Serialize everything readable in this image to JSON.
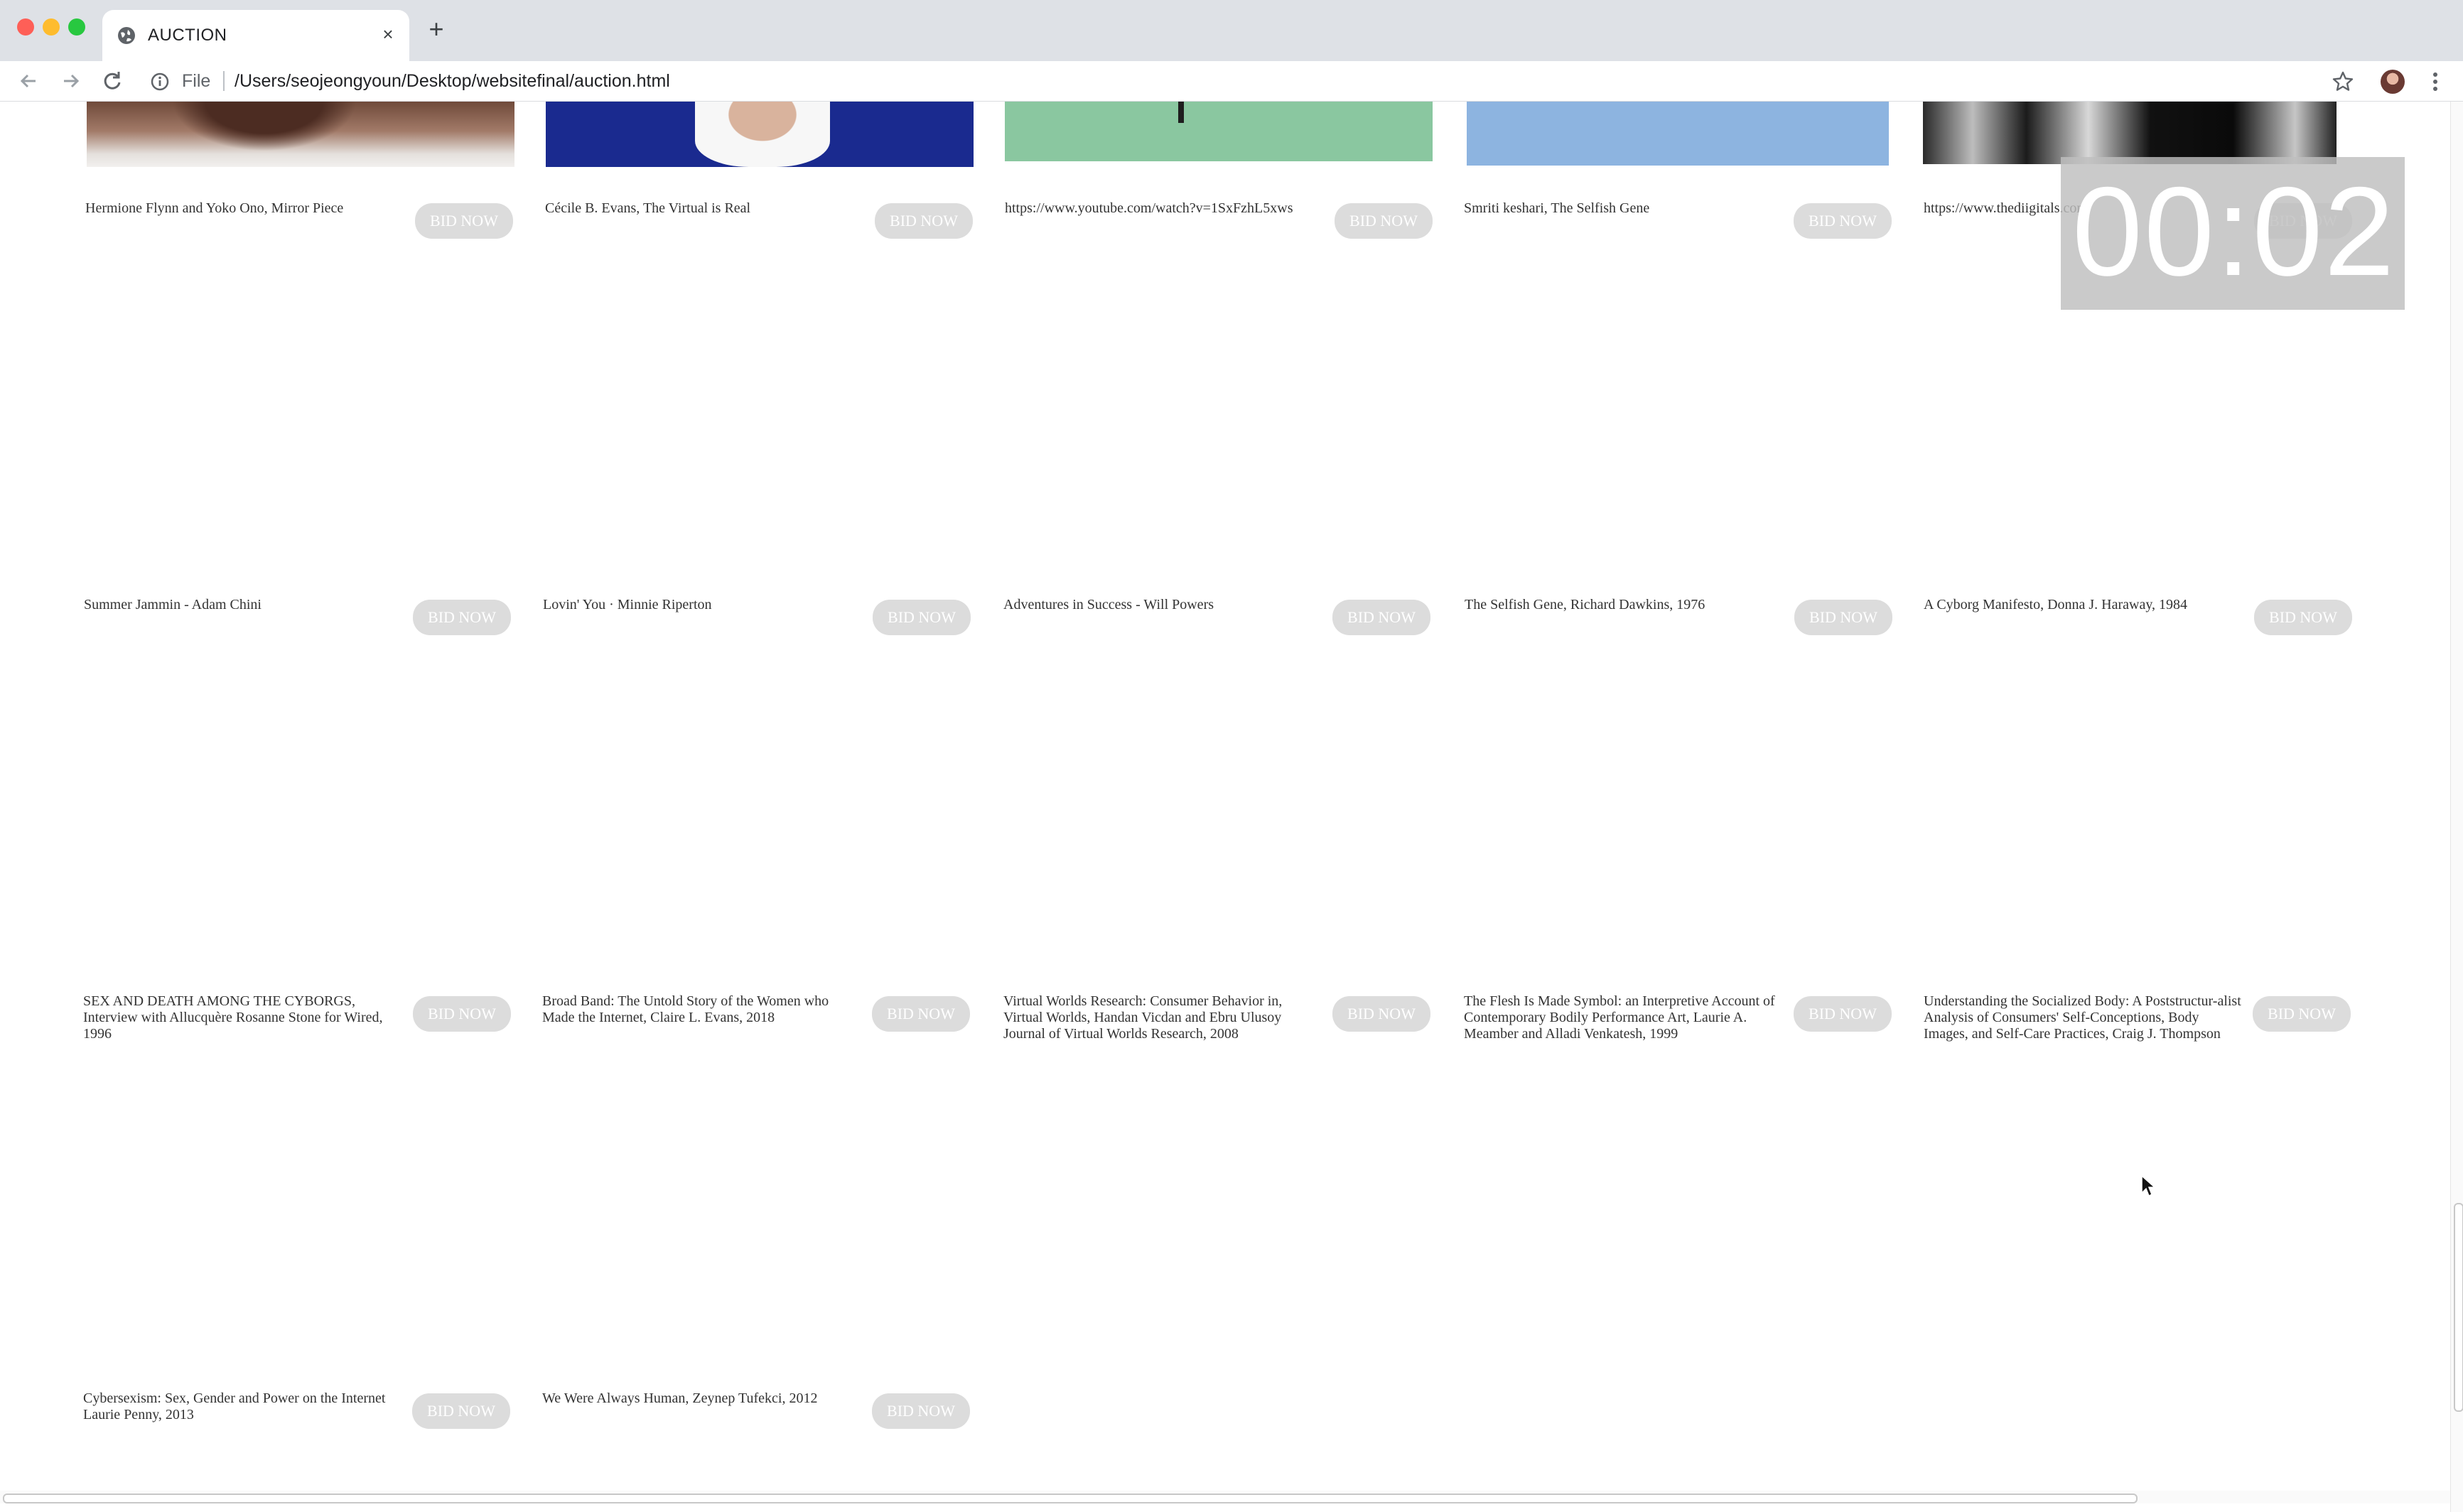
{
  "browser": {
    "tab_title": "AUCTION",
    "close_glyph": "×",
    "new_tab_glyph": "+",
    "file_label": "File",
    "url": "/Users/seojeongyoun/Desktop/websitefinal/auction.html"
  },
  "timer": {
    "text": "00:02"
  },
  "bid_label": "BID NOW",
  "items": [
    "Hermione Flynn and Yoko Ono, Mirror Piece",
    "Cécile B. Evans, The Virtual is Real",
    "https://www.youtube.com/watch?v=1SxFzhL5xws",
    "Smriti keshari, The Selfish Gene",
    "https://www.thediigitals.com/",
    "Summer Jammin - Adam Chini",
    "Lovin' You · Minnie Riperton",
    "Adventures in Success - Will Powers",
    "The Selfish Gene, Richard Dawkins, 1976",
    "A Cyborg Manifesto, Donna J. Haraway, 1984",
    "SEX AND DEATH AMONG THE CYBORGS, Interview with Allucquère Rosanne Stone for Wired, 1996",
    "Broad Band: The Untold Story of the Women who Made the Internet, Claire L. Evans, 2018",
    "Virtual Worlds Research: Consumer Behavior in, Virtual Worlds, Handan Vicdan and Ebru Ulusoy Journal of Virtual Worlds Research, 2008",
    "The Flesh Is Made Symbol: an Interpretive Account of Contemporary Bodily Performance Art, Laurie A. Meamber and Alladi Venkatesh, 1999",
    "Understanding the Socialized Body: A Poststructur-alist Analysis of Consumers' Self-Conceptions, Body Images, and Self-Care Practices, Craig J. Thompson",
    "Cybersexism: Sex, Gender and Power on the Internet Laurie Penny, 2013",
    "We Were Always Human, Zeynep Tufekci, 2012"
  ],
  "colors": {
    "button_bg": "#dcdcdc",
    "timer_bg": "#bebebe",
    "chrome_bg": "#dee1e6"
  }
}
